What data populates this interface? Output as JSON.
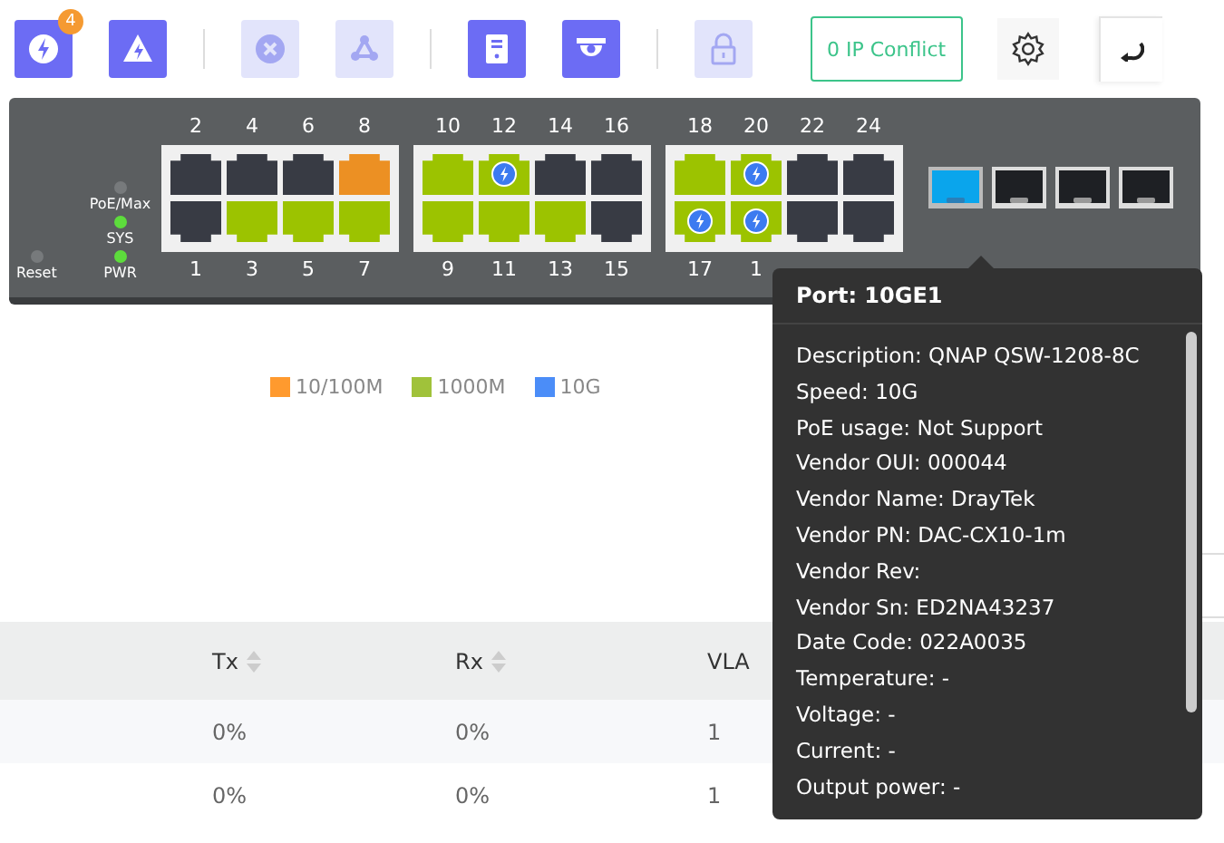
{
  "toolbar": {
    "tools": [
      {
        "kind": "poe",
        "disabled": false,
        "badge": "4"
      },
      {
        "kind": "alert",
        "disabled": false
      },
      {
        "kind": "close",
        "disabled": true
      },
      {
        "kind": "topology",
        "disabled": true
      },
      {
        "kind": "server",
        "disabled": false
      },
      {
        "kind": "camera",
        "disabled": false
      },
      {
        "kind": "lock",
        "disabled": true
      }
    ],
    "ip_conflict": "0 IP Conflict"
  },
  "switch": {
    "leds": [
      {
        "label": "PoE/Max",
        "on": false
      },
      {
        "label": "SYS",
        "on": true
      },
      {
        "label": "PWR",
        "on": true
      }
    ],
    "reset": {
      "label": "Reset",
      "on": false
    },
    "groups": [
      {
        "top": [
          {
            "label": "2",
            "color": "#383b44",
            "poe": false
          },
          {
            "label": "4",
            "color": "#383b44",
            "poe": false
          },
          {
            "label": "6",
            "color": "#383b44",
            "poe": false
          },
          {
            "label": "8",
            "color": "#ec9023",
            "poe": false
          }
        ],
        "bottom": [
          {
            "label": "1",
            "color": "#383b44",
            "poe": false
          },
          {
            "label": "3",
            "color": "#9cc300",
            "poe": false
          },
          {
            "label": "5",
            "color": "#9cc300",
            "poe": false
          },
          {
            "label": "7",
            "color": "#9cc300",
            "poe": false
          }
        ]
      },
      {
        "top": [
          {
            "label": "10",
            "color": "#9cc300",
            "poe": false
          },
          {
            "label": "12",
            "color": "#9cc300",
            "poe": true
          },
          {
            "label": "14",
            "color": "#383b44",
            "poe": false
          },
          {
            "label": "16",
            "color": "#383b44",
            "poe": false
          }
        ],
        "bottom": [
          {
            "label": "9",
            "color": "#9cc300",
            "poe": false
          },
          {
            "label": "11",
            "color": "#9cc300",
            "poe": false
          },
          {
            "label": "13",
            "color": "#9cc300",
            "poe": false
          },
          {
            "label": "15",
            "color": "#383b44",
            "poe": false
          }
        ]
      },
      {
        "top": [
          {
            "label": "18",
            "color": "#9cc300",
            "poe": false
          },
          {
            "label": "20",
            "color": "#9cc300",
            "poe": true
          },
          {
            "label": "22",
            "color": "#383b44",
            "poe": false
          },
          {
            "label": "24",
            "color": "#383b44",
            "poe": false
          }
        ],
        "bottom": [
          {
            "label": "17",
            "color": "#9cc300",
            "poe": true
          },
          {
            "label": "1",
            "color": "#9cc300",
            "poe": true
          },
          {
            "color": "#383b44",
            "poe": false
          },
          {
            "color": "#383b44",
            "poe": false
          }
        ]
      }
    ],
    "sfp": [
      {
        "color": "#0aa5ec",
        "selected": true
      },
      {
        "color": "#1e2024",
        "selected": false
      },
      {
        "color": "#1e2024",
        "selected": false
      },
      {
        "color": "#1e2024",
        "selected": false
      }
    ]
  },
  "legend": [
    {
      "label": "10/100M",
      "color": "#ff9a2e"
    },
    {
      "label": "1000M",
      "color": "#a0c23a"
    },
    {
      "label": "10G",
      "color": "#4b8df8"
    }
  ],
  "table": {
    "columns": [
      "Tx",
      "Rx",
      "VLA"
    ],
    "rows": [
      {
        "cells": [
          "0%",
          "0%",
          "1"
        ]
      },
      {
        "cells": [
          "0%",
          "0%",
          "1"
        ]
      }
    ]
  },
  "tooltip": {
    "title": "Port: 10GE1",
    "lines": [
      "Description: QNAP QSW-1208-8C",
      "Speed: 10G",
      "PoE usage: Not Support",
      "Vendor OUI: 000044",
      "Vendor Name: DrayTek",
      "Vendor PN: DAC-CX10-1m",
      "Vendor Rev:",
      "Vendor Sn: ED2NA43237",
      "Date Code: 022A0035",
      "Temperature: -",
      "Voltage: -",
      "Current: -",
      "Output power: -"
    ]
  }
}
